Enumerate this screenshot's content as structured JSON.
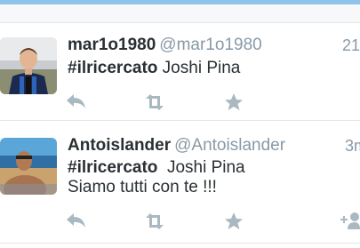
{
  "colors": {
    "accent": "#55acee",
    "name_text": "#292f33",
    "meta_text": "#8899a6",
    "action_icon": "#aab8c2"
  },
  "tweets": [
    {
      "display_name": "mar1o1980",
      "screen_name": "@mar1o1980",
      "timestamp": "21",
      "hashtag": "#ilricercato",
      "text": " Joshi Pina",
      "text_line2": "",
      "actions": [
        "reply-icon",
        "retweet-icon",
        "favorite-icon"
      ]
    },
    {
      "display_name": "Antoislander",
      "screen_name": "@Antoislander",
      "timestamp": "3m",
      "hashtag": "#ilricercato",
      "text": "  Joshi Pina",
      "text_line2": "Siamo tutti con te !!!",
      "actions": [
        "reply-icon",
        "retweet-icon",
        "favorite-icon",
        "follow-icon"
      ]
    }
  ]
}
